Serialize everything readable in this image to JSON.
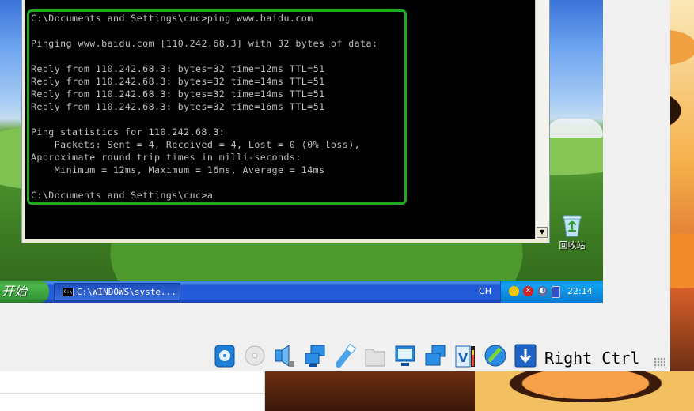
{
  "console": {
    "lines": [
      "C:\\Documents and Settings\\cuc>ping www.baidu.com",
      "",
      "Pinging www.baidu.com [110.242.68.3] with 32 bytes of data:",
      "",
      "Reply from 110.242.68.3: bytes=32 time=12ms TTL=51",
      "Reply from 110.242.68.3: bytes=32 time=14ms TTL=51",
      "Reply from 110.242.68.3: bytes=32 time=14ms TTL=51",
      "Reply from 110.242.68.3: bytes=32 time=16ms TTL=51",
      "",
      "Ping statistics for 110.242.68.3:",
      "    Packets: Sent = 4, Received = 4, Lost = 0 (0% loss),",
      "Approximate round trip times in milli-seconds:",
      "    Minimum = 12ms, Maximum = 16ms, Average = 14ms",
      "",
      "C:\\Documents and Settings\\cuc>a"
    ],
    "highlight_color": "#1faa1f"
  },
  "desktop": {
    "recycle_bin_label": "回收站"
  },
  "taskbar": {
    "start_label": "开始",
    "task_label": "C:\\WINDOWS\\syste...",
    "task_icon_text": "C:\\",
    "language": "CH",
    "clock": "22:14",
    "tray_icons": [
      "shield-icon",
      "security-alert-icon",
      "network-icon",
      "battery-icon"
    ]
  },
  "vbox_statusbar": {
    "icons": [
      "hard-disk-icon",
      "optical-drive-icon",
      "audio-icon",
      "network-icon",
      "usb-icon",
      "shared-folders-icon",
      "display-icon",
      "screen-capture-icon",
      "video-capture-icon",
      "mouse-integration-icon",
      "keyboard-capture-icon"
    ],
    "host_key": "Right Ctrl"
  }
}
